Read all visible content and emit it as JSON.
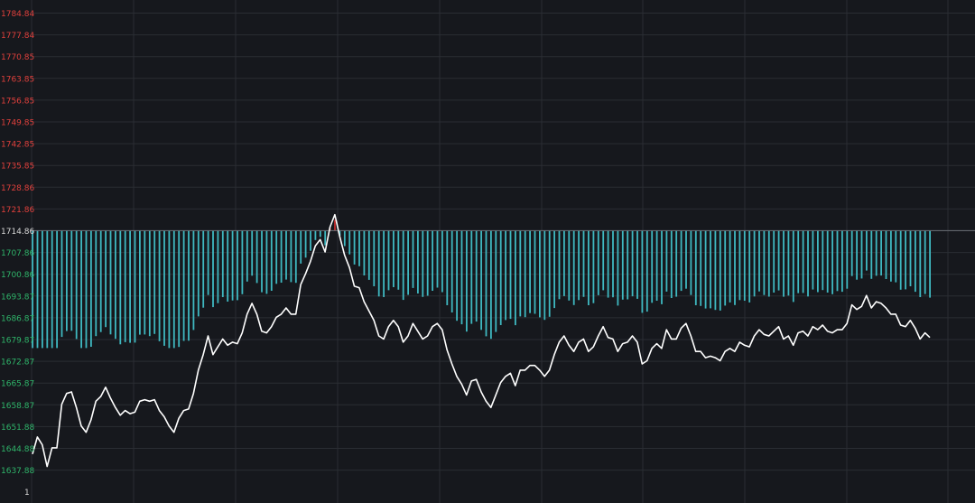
{
  "chart_data": {
    "type": "line",
    "title": "",
    "xlabel": "",
    "ylabel": "",
    "baseline": 1714.86,
    "ylim": [
      1633.88,
      1786.84
    ],
    "y_ticks": [
      "1784.84",
      "1777.84",
      "1770.85",
      "1763.85",
      "1756.85",
      "1749.85",
      "1742.85",
      "1735.85",
      "1728.86",
      "1721.86",
      "1714.86",
      "1707.86",
      "1700.86",
      "1693.87",
      "1686.87",
      "1679.87",
      "1672.87",
      "1665.87",
      "1658.87",
      "1651.88",
      "1644.88",
      "1637.88"
    ],
    "extra_tick": "1",
    "colors": {
      "background": "#16181d",
      "grid": "#2a2d33",
      "up": "#c42b2b",
      "down": "#3fb8c0",
      "line": "#ffffff",
      "tick_up": "#e0403c",
      "tick_down": "#2fb56a",
      "tick_base": "#d8d8d8"
    },
    "line_values": [
      1643.0,
      1648.5,
      1646.0,
      1639.0,
      1645.0,
      1645.0,
      1659.0,
      1662.5,
      1663.0,
      1658.0,
      1652.0,
      1650.0,
      1654.0,
      1660.0,
      1661.5,
      1664.5,
      1661.0,
      1658.0,
      1655.5,
      1657.0,
      1656.0,
      1656.5,
      1660.0,
      1660.5,
      1660.0,
      1660.5,
      1657.0,
      1655.0,
      1652.0,
      1650.0,
      1654.5,
      1657.0,
      1657.5,
      1662.5,
      1670.0,
      1675.0,
      1681.0,
      1675.0,
      1677.5,
      1680.0,
      1678.0,
      1679.0,
      1678.5,
      1682.0,
      1688.0,
      1691.5,
      1688.0,
      1682.5,
      1682.0,
      1684.0,
      1687.0,
      1688.0,
      1690.0,
      1688.0,
      1688.0,
      1697.5,
      1701.0,
      1705.0,
      1710.0,
      1712.0,
      1708.0,
      1716.0,
      1720.0,
      1713.0,
      1707.0,
      1703.0,
      1697.0,
      1696.5,
      1692.0,
      1689.0,
      1686.0,
      1681.0,
      1680.0,
      1684.0,
      1686.0,
      1684.0,
      1679.0,
      1681.0,
      1685.0,
      1682.5,
      1680.0,
      1681.0,
      1684.0,
      1685.0,
      1683.0,
      1676.5,
      1672.0,
      1668.0,
      1665.5,
      1662.0,
      1666.5,
      1667.0,
      1663.0,
      1660.0,
      1658.0,
      1662.0,
      1666.0,
      1668.0,
      1669.0,
      1665.0,
      1670.0,
      1670.0,
      1671.5,
      1671.5,
      1670.0,
      1668.0,
      1670.0,
      1675.0,
      1679.0,
      1681.0,
      1678.0,
      1676.0,
      1679.0,
      1680.0,
      1676.0,
      1677.5,
      1681.0,
      1684.0,
      1680.5,
      1680.0,
      1676.0,
      1678.5,
      1679.0,
      1681.0,
      1679.0,
      1672.0,
      1673.0,
      1677.0,
      1678.5,
      1677.0,
      1683.0,
      1680.0,
      1680.0,
      1683.5,
      1685.0,
      1681.0,
      1676.0,
      1676.0,
      1674.0,
      1674.5,
      1674.0,
      1673.0,
      1676.0,
      1677.0,
      1676.0,
      1679.0,
      1678.0,
      1677.5,
      1681.0,
      1683.0,
      1681.5,
      1681.0,
      1682.5,
      1684.0,
      1680.0,
      1681.0,
      1678.0,
      1682.0,
      1682.5,
      1681.0,
      1684.0,
      1683.0,
      1684.5,
      1682.5,
      1682.0,
      1683.0,
      1683.0,
      1685.0,
      1691.0,
      1689.5,
      1690.5,
      1694.0,
      1690.0,
      1692.0,
      1691.5,
      1690.0,
      1688.0,
      1688.0,
      1684.5,
      1684.0,
      1686.0,
      1683.5,
      1680.0,
      1682.0,
      1680.5
    ]
  }
}
